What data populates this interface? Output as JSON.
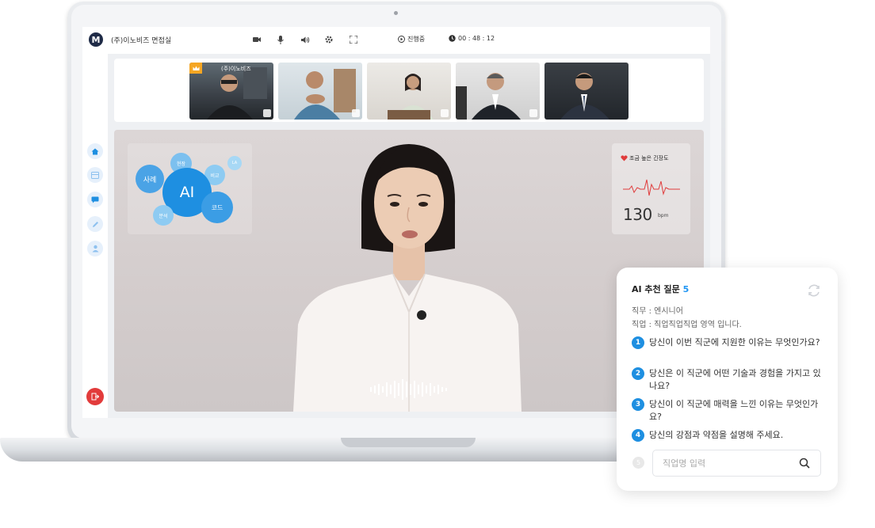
{
  "app": {
    "logo_letter": "M",
    "room_title": "(주)이노비즈 면접실",
    "status_label": "진행중",
    "timer": "00 : 48 : 12"
  },
  "toolbar": {
    "icons": [
      "video-icon",
      "mic-icon",
      "speaker-icon",
      "settings-icon",
      "fullscreen-icon"
    ]
  },
  "sidebar": {
    "items": [
      "home-icon",
      "grid-icon",
      "chat-icon",
      "pen-icon",
      "user-icon"
    ],
    "exit_icon": "exit-icon",
    "exit_color": "#e23b3b"
  },
  "participants": {
    "host_name": "(주)이노비즈",
    "count": 5
  },
  "ai_keywords": {
    "center": "AI",
    "bubbles": [
      "사례",
      "현장",
      "비교",
      "LA",
      "코드",
      "분석"
    ]
  },
  "heart_rate": {
    "label": "조금 높은 긴장도",
    "value": "130",
    "unit": "bpm"
  },
  "questions": {
    "title": "AI 추천 질문",
    "count": "5",
    "job_line": "직무 : 엔시니어",
    "field_line": "직업 : 직업직업직업 영역 입니다.",
    "items": [
      {
        "num": "1",
        "text": "당신이 이번 직군에 지원한 이유는 무엇인가요?"
      },
      {
        "num": "2",
        "text": "당신은 이 직군에 어떤 기술과 경험을 가지고 있나요?"
      },
      {
        "num": "3",
        "text": "당신이 이 직군에 매력을 느낀 이유는 무엇인가요?"
      },
      {
        "num": "4",
        "text": "당신의 강점과 약점을 설명해 주세요."
      }
    ],
    "input_num": "5",
    "input_placeholder": "직업명 입력"
  },
  "colors": {
    "accent": "#1e8fe1",
    "logo_bg": "#1f2b47",
    "host_badge": "#f5a623",
    "heart": "#e03c3c"
  }
}
